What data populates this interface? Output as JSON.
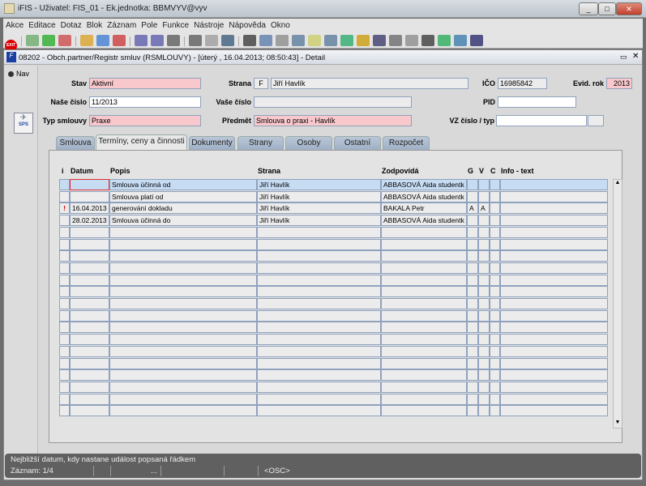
{
  "window": {
    "title": "iFIS - Uživatel: FIS_01 - Ek.jednotka: BBMVYV@vyv"
  },
  "menu": [
    "Akce",
    "Editace",
    "Dotaz",
    "Blok",
    "Záznam",
    "Pole",
    "Funkce",
    "Nástroje",
    "Nápověda",
    "Okno"
  ],
  "toolbar": {
    "exit_label": "EXIT",
    "icons": [
      "exit-icon",
      "insert-record-icon",
      "save-record-icon",
      "delete-record-icon",
      "query-enter-icon",
      "query-execute-icon",
      "query-cancel-icon",
      "sort-asc-icon",
      "sort-desc-icon",
      "filter-icon",
      "print-icon",
      "print-preview-icon",
      "mail-icon",
      "cut-icon",
      "copy-icon",
      "paste-icon",
      "find-icon",
      "tree-icon",
      "document-icon",
      "globe-icon",
      "star-icon",
      "chart-icon",
      "report-icon",
      "edit-icon",
      "sum-icon",
      "excel-icon",
      "refresh-icon",
      "help-icon"
    ]
  },
  "inner": {
    "title": "08202 - Obch.partner/Registr smluv (RSMLOUVY) - [úterý , 16.04.2013; 08:50:43] - Detail"
  },
  "nav": {
    "label": "Nav",
    "sps_label": "SPS"
  },
  "form": {
    "stav_label": "Stav",
    "stav": "Aktivní",
    "strana_label": "Strana",
    "strana_type": "F",
    "strana": "Jiří Havlík",
    "ico_label": "IČO",
    "ico": "16985842",
    "evid_label": "Evid. rok",
    "evid": "2013",
    "nase_label": "Naše číslo",
    "nase": "11/2013",
    "vase_label": "Vaše číslo",
    "vase": "",
    "pid_label": "PID",
    "pid": "",
    "typ_label": "Typ smlouvy",
    "typ": "Praxe",
    "predmet_label": "Předmět",
    "predmet": "Smlouva o praxi - Havlík",
    "vz_label": "VZ číslo / typ",
    "vz": "",
    "vz_typ": ""
  },
  "tabs": [
    "Smlouva",
    "Termíny, ceny a činnosti",
    "Dokumenty",
    "Strany",
    "Osoby",
    "Ostatní",
    "Rozpočet"
  ],
  "table": {
    "headers": [
      "i",
      "Datum",
      "Popis",
      "Strana",
      "Zodpovídá",
      "G",
      "V",
      "C",
      "Info - text"
    ],
    "rows": [
      [
        "",
        "",
        "Smlouva účinná od",
        "Jiří Havlík",
        "ABBASOVÁ Aida  studentk",
        "",
        "",
        "",
        ""
      ],
      [
        "",
        "",
        "Smlouva platí od",
        "Jiří Havlík",
        "ABBASOVÁ Aida  studentk",
        "",
        "",
        "",
        ""
      ],
      [
        "!",
        "16.04.2013",
        "generování dokladu",
        "Jiří Havlík",
        "BAKALA Petr",
        "A",
        "A",
        "",
        ""
      ],
      [
        "",
        "28.02.2013",
        "Smlouva účinná do",
        "Jiří Havlík",
        "ABBASOVÁ Aida  studentk",
        "",
        "",
        "",
        ""
      ]
    ],
    "empty_rows": 16
  },
  "status": {
    "hint": "Nejbližší datum, kdy nastane událost popsaná řádkem",
    "record": "Záznam: 1/4",
    "dots": "...",
    "mode": "<OSC>"
  }
}
